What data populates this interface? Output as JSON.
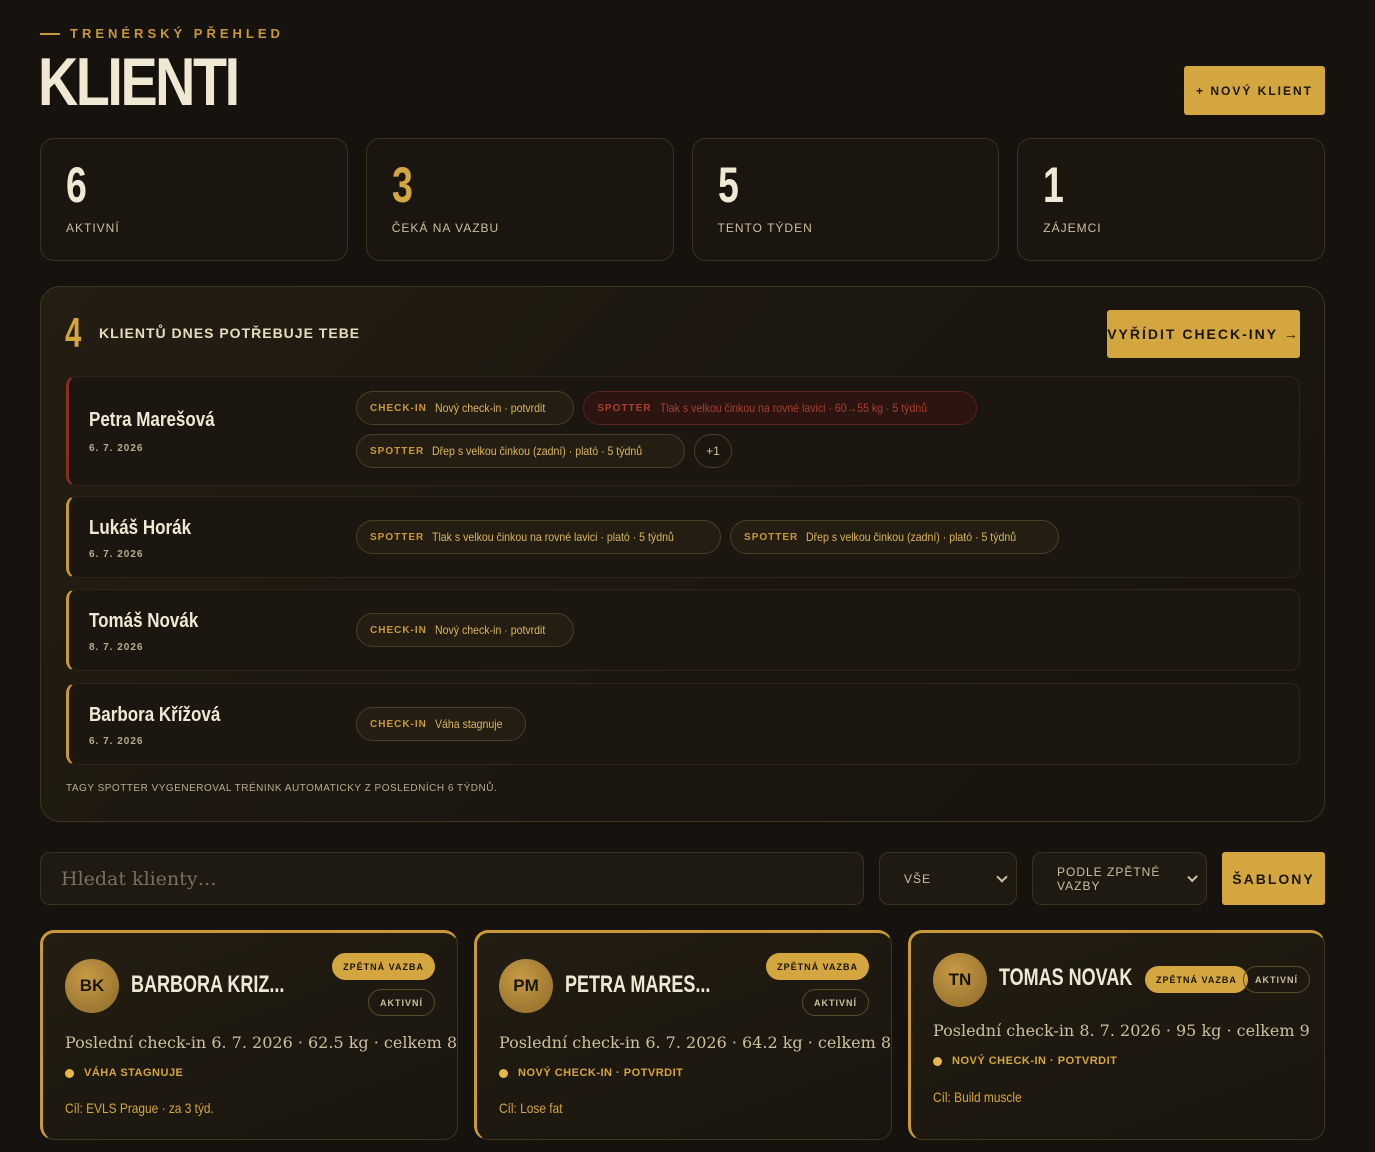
{
  "header": {
    "eyebrow": "TRENÉRSKÝ PŘEHLED",
    "title": "KLIENTI",
    "new_client_label": "+ NOVÝ KLIENT"
  },
  "stats": [
    {
      "value": "6",
      "label": "AKTIVNÍ"
    },
    {
      "value": "3",
      "label": "ČEKÁ NA VAZBU"
    },
    {
      "value": "5",
      "label": "TENTO TÝDEN"
    },
    {
      "value": "1",
      "label": "ZÁJEMCI"
    }
  ],
  "attention": {
    "count": "4",
    "title": "KLIENTŮ DNES POTŘEBUJE TEBE",
    "action_label": "VYŘÍDIT CHECK-INY →",
    "footnote": "TAGY SPOTTER VYGENEROVAL TRÉNINK AUTOMATICKY Z POSLEDNÍCH 6 TÝDNŮ.",
    "rows": [
      {
        "name": "Petra Marešová",
        "date": "6. 7. 2026",
        "tags": [
          {
            "kind": "CHECK-IN",
            "text": "Nový check-in · potvrdit"
          },
          {
            "kind": "SPOTTER",
            "text": "Tlak s velkou činkou na rovné lavici · 60→55 kg · 5 týdnů"
          },
          {
            "kind": "SPOTTER",
            "text": "Dřep s velkou činkou (zadní) · plató · 5 týdnů"
          }
        ],
        "more": "+1"
      },
      {
        "name": "Lukáš Horák",
        "date": "6. 7. 2026",
        "tags": [
          {
            "kind": "SPOTTER",
            "text": "Tlak s velkou činkou na rovné lavici · plató · 5 týdnů"
          },
          {
            "kind": "SPOTTER",
            "text": "Dřep s velkou činkou (zadní) · plató · 5 týdnů"
          }
        ]
      },
      {
        "name": "Tomáš Novák",
        "date": "8. 7. 2026",
        "tags": [
          {
            "kind": "CHECK-IN",
            "text": "Nový check-in · potvrdit"
          }
        ]
      },
      {
        "name": "Barbora Křížová",
        "date": "6. 7. 2026",
        "tags": [
          {
            "kind": "CHECK-IN",
            "text": "Váha stagnuje"
          }
        ]
      }
    ]
  },
  "filters": {
    "search_placeholder": "Hledat klienty…",
    "status_value": "VŠE",
    "sort_value": "PODLE ZPĚTNÉ VAZBY",
    "templates_label": "ŠABLONY"
  },
  "cards": [
    {
      "initials": "BK",
      "name": "BARBORA KRIZ...",
      "badge_feedback": "ZPĚTNÁ VAZBA",
      "badge_status": "AKTIVNÍ",
      "info": "Poslední check-in 6. 7. 2026 · 62.5 kg · celkem 8",
      "flag": "VÁHA STAGNUJE",
      "goal": "Cíl: EVLS Prague · za 3 týd."
    },
    {
      "initials": "PM",
      "name": "PETRA MARES...",
      "badge_feedback": "ZPĚTNÁ VAZBA",
      "badge_status": "AKTIVNÍ",
      "info": "Poslední check-in 6. 7. 2026 · 64.2 kg · celkem 8",
      "flag": "NOVÝ CHECK-IN · POTVRDIT",
      "goal": "Cíl: Lose fat"
    },
    {
      "initials": "TN",
      "name": "TOMAS NOVAK",
      "badge_feedback": "ZPĚTNÁ VAZBA",
      "badge_status": "AKTIVNÍ",
      "info": "Poslední check-in 8. 7. 2026 · 95 kg · celkem 9",
      "flag": "NOVÝ CHECK-IN · POTVRDIT",
      "goal": "Cíl: Build muscle"
    }
  ]
}
